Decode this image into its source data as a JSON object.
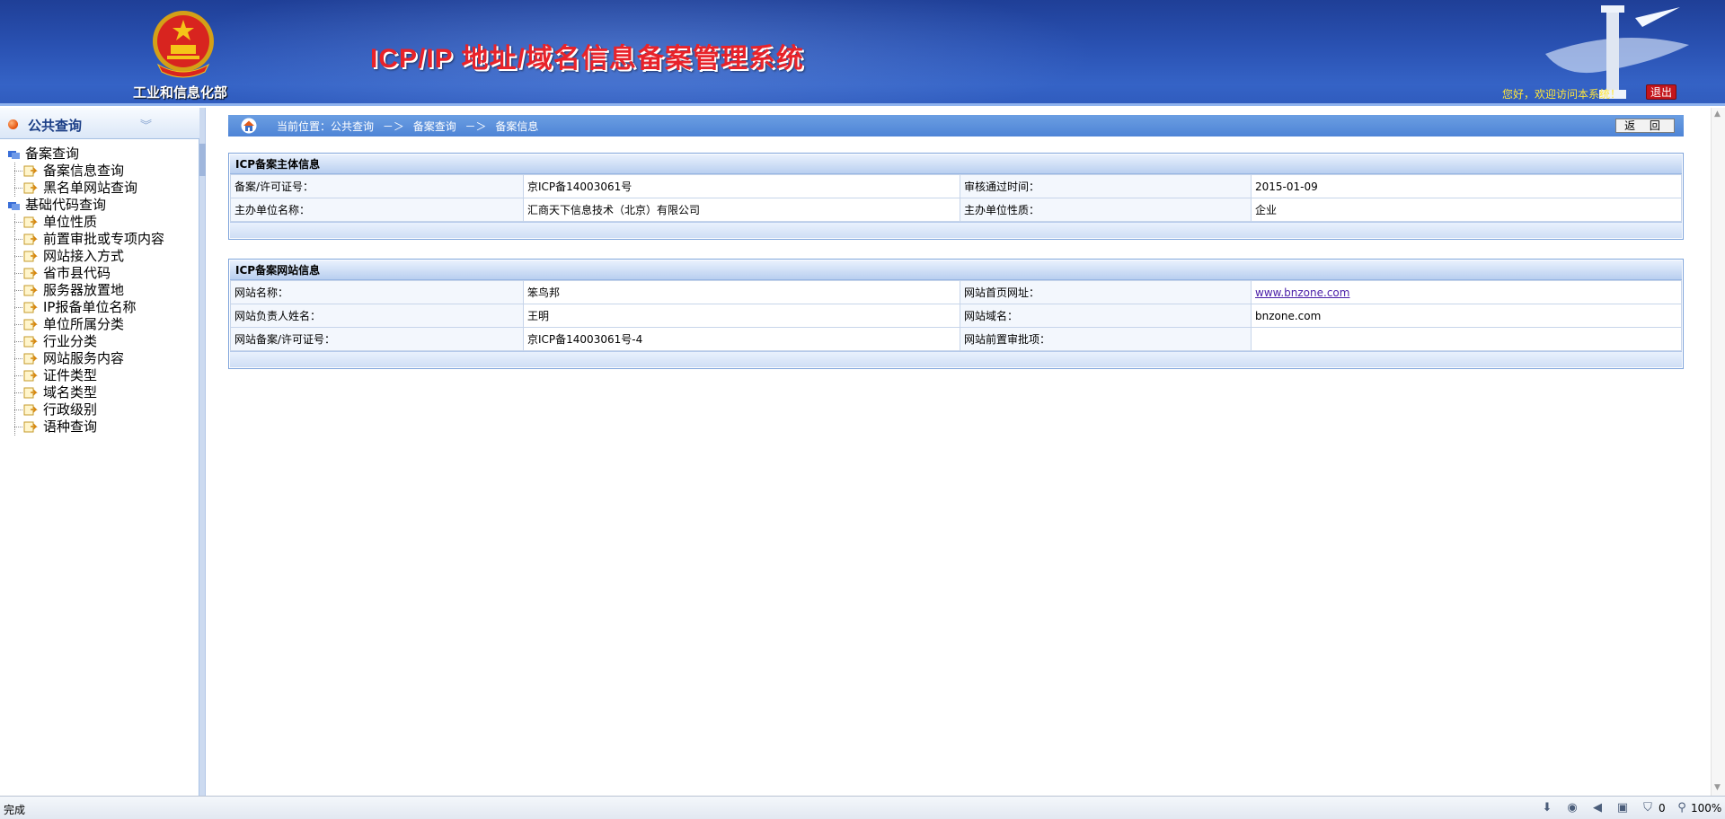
{
  "header": {
    "ministry": "工业和信息化部",
    "system_title": "ICP/IP 地址/域名信息备案管理系统",
    "welcome": "您好，欢迎访问本系统！",
    "logout": "退出"
  },
  "sidebar": {
    "title": "公共查询",
    "groups": [
      {
        "label": "备案查询",
        "items": [
          "备案信息查询",
          "黑名单网站查询"
        ]
      },
      {
        "label": "基础代码查询",
        "items": [
          "单位性质",
          "前置审批或专项内容",
          "网站接入方式",
          "省市县代码",
          "服务器放置地",
          "IP报备单位名称",
          "单位所属分类",
          "行业分类",
          "网站服务内容",
          "证件类型",
          "域名类型",
          "行政级别",
          "语种查询"
        ]
      }
    ]
  },
  "breadcrumb": {
    "prefix": "当前位置：公共查询",
    "sep1": "－＞",
    "level2": "备案查询",
    "sep2": "－＞",
    "level3": "备案信息"
  },
  "back_button": "返 回",
  "subject_panel": {
    "title": "ICP备案主体信息",
    "rows": [
      {
        "k1": "备案/许可证号：",
        "v1": "京ICP备14003061号",
        "k2": "审核通过时间：",
        "v2": "2015-01-09"
      },
      {
        "k1": "主办单位名称：",
        "v1": "汇商天下信息技术（北京）有限公司",
        "k2": "主办单位性质：",
        "v2": "企业"
      }
    ]
  },
  "site_panel": {
    "title": "ICP备案网站信息",
    "rows": [
      {
        "k1": "网站名称：",
        "v1": "笨鸟邦",
        "k2": "网站首页网址：",
        "v2": "www.bnzone.com"
      },
      {
        "k1": "网站负责人姓名：",
        "v1": "王明",
        "k2": "网站域名：",
        "v2": "bnzone.com"
      },
      {
        "k1": "网站备案/许可证号：",
        "v1": "京ICP备14003061号-4",
        "k2": "网站前置审批项：",
        "v2": ""
      }
    ]
  },
  "status": {
    "text": "完成",
    "count": "0",
    "zoom": "100%"
  },
  "icons": {
    "emblem": "national-emblem-icon",
    "home": "home-icon",
    "group": "folder-group-icon",
    "doc": "doc-arrow-icon"
  },
  "colors": {
    "header_blue": "#2a52b3",
    "title_red": "#e8232a",
    "welcome_yellow": "#ffe63a",
    "logout_red": "#c4161c",
    "crumb_blue": "#5b8fdc"
  }
}
